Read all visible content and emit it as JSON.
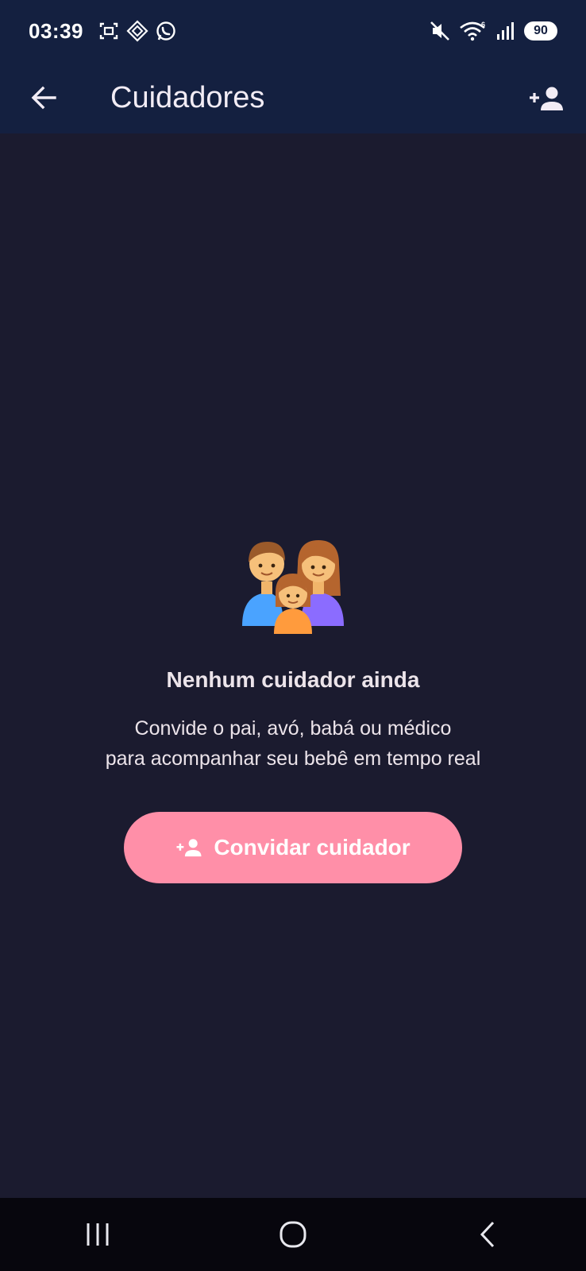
{
  "status_bar": {
    "time": "03:39",
    "battery_level": "90",
    "icons": [
      "screenshot-icon",
      "app-notification-icon",
      "whatsapp-icon",
      "mute-icon",
      "wifi-icon",
      "signal-icon",
      "battery-icon"
    ]
  },
  "app_bar": {
    "title": "Cuidadores",
    "back_icon": "arrow-back-icon",
    "action_icon": "person-add-icon"
  },
  "empty_state": {
    "illustration": "family-icon",
    "title": "Nenhum cuidador ainda",
    "description_line1": "Convide o pai, avó, babá ou médico",
    "description_line2": "para acompanhar seu bebê em tempo real",
    "button_label": "Convidar cuidador"
  },
  "nav_bar": {
    "items": [
      "recents-icon",
      "home-icon",
      "back-icon"
    ]
  },
  "colors": {
    "background": "#1b1b2f",
    "app_bar": "#142040",
    "accent": "#ff8fa8",
    "nav_bar": "#07060d"
  }
}
